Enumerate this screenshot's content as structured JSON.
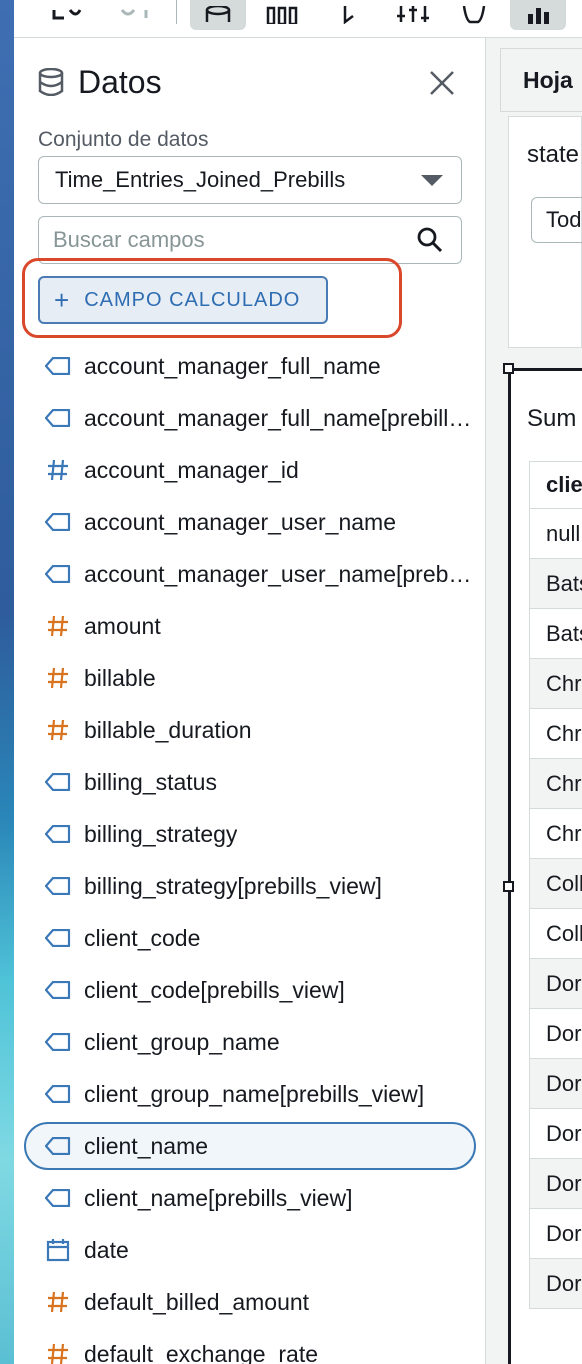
{
  "panel": {
    "title": "Datos",
    "dataset_label": "Conjunto de datos",
    "dataset_value": "Time_Entries_Joined_Prebills",
    "search_placeholder": "Buscar campos",
    "calc_button": "CAMPO CALCULADO"
  },
  "fields": [
    {
      "name": "account_manager_full_name",
      "type": "string"
    },
    {
      "name": "account_manager_full_name[prebills_view]",
      "type": "string"
    },
    {
      "name": "account_manager_id",
      "type": "number-dimension"
    },
    {
      "name": "account_manager_user_name",
      "type": "string"
    },
    {
      "name": "account_manager_user_name[prebills_view]",
      "type": "string"
    },
    {
      "name": "amount",
      "type": "number-measure"
    },
    {
      "name": "billable",
      "type": "number-measure"
    },
    {
      "name": "billable_duration",
      "type": "number-measure"
    },
    {
      "name": "billing_status",
      "type": "string"
    },
    {
      "name": "billing_strategy",
      "type": "string"
    },
    {
      "name": "billing_strategy[prebills_view]",
      "type": "string"
    },
    {
      "name": "client_code",
      "type": "string"
    },
    {
      "name": "client_code[prebills_view]",
      "type": "string"
    },
    {
      "name": "client_group_name",
      "type": "string"
    },
    {
      "name": "client_group_name[prebills_view]",
      "type": "string"
    },
    {
      "name": "client_name",
      "type": "string",
      "selected": true
    },
    {
      "name": "client_name[prebills_view]",
      "type": "string"
    },
    {
      "name": "date",
      "type": "date"
    },
    {
      "name": "default_billed_amount",
      "type": "number-measure"
    },
    {
      "name": "default_exchange_rate",
      "type": "number-measure"
    }
  ],
  "sheet": {
    "tab_label": "Hoja",
    "control_title": "state",
    "control_value": "Tod",
    "visual_title": "Sum",
    "table_header": "clie",
    "rows": [
      "null",
      "Bats",
      "Bats",
      "Chr",
      "Chr",
      "Chr",
      "Chr",
      "Coll",
      "Coll",
      "Dor",
      "Dor",
      "Dor",
      "Dor",
      "Dor",
      "Dor",
      "Dor"
    ]
  },
  "colors": {
    "accent": "#2f6db3",
    "highlight": "#d9482b",
    "measure": "#d8731f",
    "dimension": "#3a78b8"
  }
}
